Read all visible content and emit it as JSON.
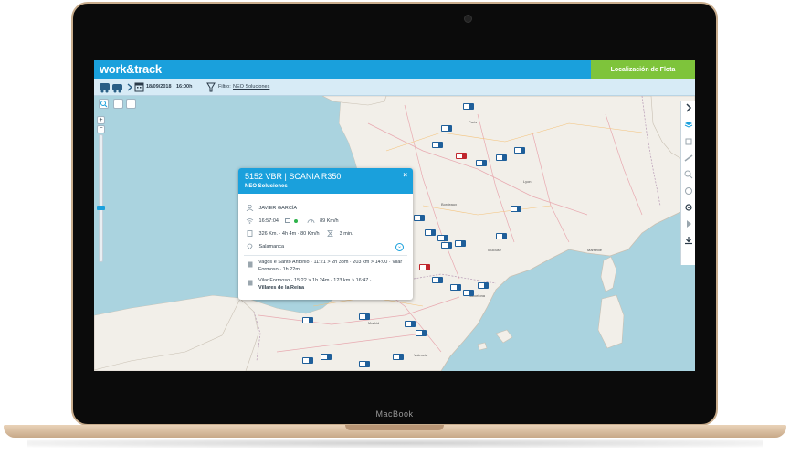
{
  "app": {
    "logo": "work&track",
    "section_button": "Localización de Flota"
  },
  "toolbar": {
    "date": "18/09/2018",
    "time": "16:00h",
    "filter_label": "Filtro:",
    "filter_value": "NEO Soluciones"
  },
  "popup": {
    "title": "5152 VBR  |  SCANIA R350",
    "company": "NEO Soluciones",
    "driver": "JAVIER GARCÍA",
    "time": "16:57:04",
    "speed": "89 Km/h",
    "distance_info": "326 Km. · 4h 4m · 80 Km/h",
    "stop_time": "3 min.",
    "location": "Salamanca",
    "route1": "Vagos e Santo António · 11:21 > 2h 38m · 203 km > 14:00 · Vilar Formoso · 1h 22m",
    "route2_a": "Vilar Formoso · 15:22 > 1h 24m · 123 km > 16:47 ·",
    "route2_b": "Villares de la Reina",
    "close": "×",
    "expand": "⌄"
  },
  "laptop": {
    "brand": "MacBook"
  },
  "colors": {
    "primary": "#1aa0dc",
    "accent_green": "#7ec43b",
    "sea": "#aad3df",
    "land": "#f2efe9"
  },
  "icons": {
    "vehicles": "truck-icon",
    "calendar": "calendar-icon",
    "filter": "filter-icon",
    "driver": "user-icon",
    "signal": "wifi-icon",
    "speed": "speedometer-icon",
    "location": "pin-icon",
    "close": "close-icon"
  }
}
